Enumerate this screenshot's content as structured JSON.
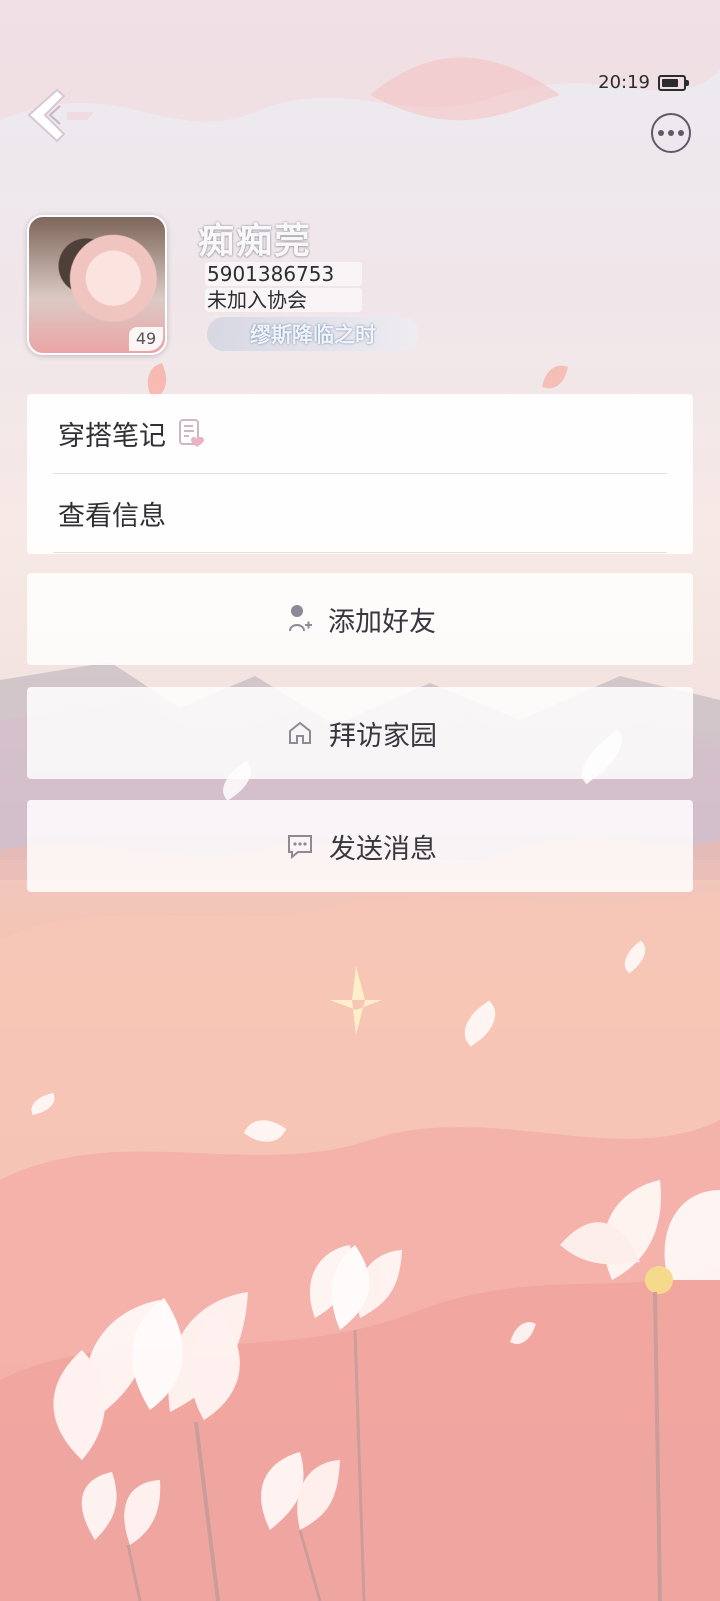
{
  "status": {
    "time": "20:19"
  },
  "profile": {
    "nickname": "痴痴莞",
    "id": "5901386753",
    "guild": "未加入协会",
    "title": "缪斯降临之时",
    "avatar_level": "49"
  },
  "menu": {
    "outfit_notes": "穿搭笔记",
    "view_info": "查看信息"
  },
  "actions": {
    "add_friend": "添加好友",
    "visit_home": "拜访家园",
    "send_message": "发送消息"
  },
  "icons": {
    "back": "back-arrow-icon",
    "more": "more-options-icon",
    "notes": "notebook-icon",
    "add_friend": "user-plus-icon",
    "home": "home-icon",
    "message": "chat-bubble-icon"
  },
  "colors": {
    "text": "#2f2f34",
    "icon": "#7e7c87",
    "accent_pink": "#f1aaa5"
  }
}
